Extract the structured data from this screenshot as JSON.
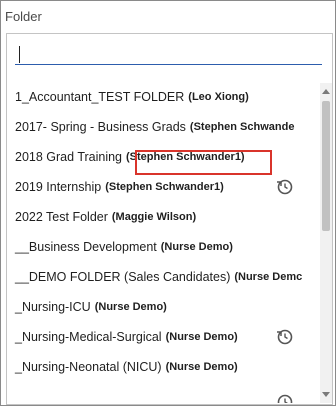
{
  "field_label": "Folder",
  "search": {
    "value": "",
    "placeholder": ""
  },
  "folders": [
    {
      "name": "1_Accountant_TEST FOLDER",
      "owner": "(Leo Xiong)"
    },
    {
      "name": "2017- Spring - Business Grads",
      "owner": "(Stephen Schwande"
    },
    {
      "name": "2018 Grad Training",
      "owner": "(Stephen Schwander1)"
    },
    {
      "name": "2019 Internship",
      "owner": "(Stephen Schwander1)"
    },
    {
      "name": "2022 Test Folder",
      "owner": "(Maggie Wilson)"
    },
    {
      "name": "__Business Development",
      "owner": "(Nurse Demo)"
    },
    {
      "name": "__DEMO FOLDER (Sales Candidates)",
      "owner": "(Nurse Demc"
    },
    {
      "name": "_Nursing-ICU",
      "owner": "(Nurse Demo)"
    },
    {
      "name": "_Nursing-Medical-Surgical",
      "owner": "(Nurse Demo)"
    },
    {
      "name": "_Nursing-Neonatal (NICU)",
      "owner": "(Nurse Demo)"
    },
    {
      "name": "",
      "owner": ""
    }
  ],
  "icons": {
    "shared": "shared-clock-icon"
  },
  "colors": {
    "highlight": "#d9342b",
    "input_underline": "#2d5dad"
  }
}
